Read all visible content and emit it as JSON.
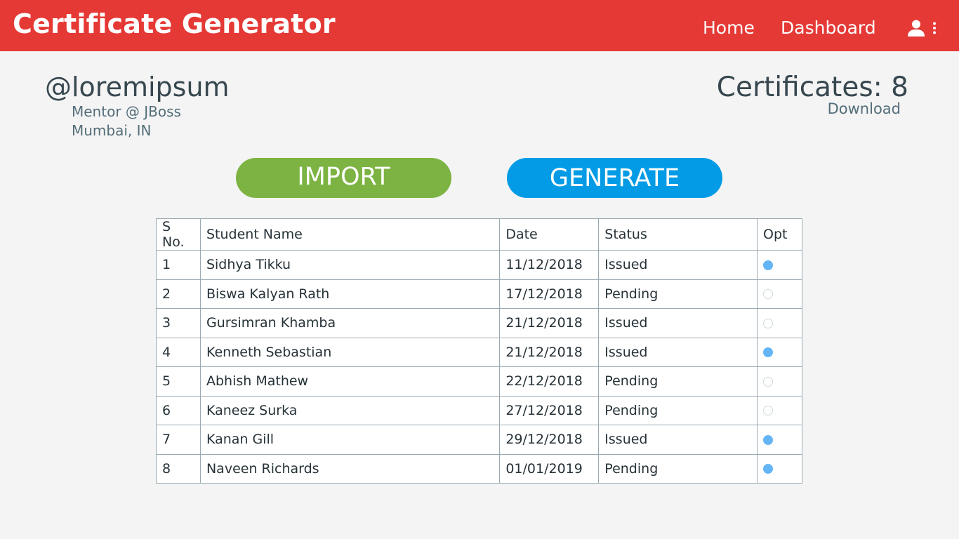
{
  "header": {
    "title": "Certificate Generator",
    "nav": {
      "home": "Home",
      "dashboard": "Dashboard"
    },
    "icons": {
      "user": "user-icon",
      "menu": "more-vertical-icon"
    }
  },
  "profile": {
    "handle": "@loremipsum",
    "role": "Mentor @ JBoss",
    "location": "Mumbai, IN"
  },
  "certificates": {
    "label": "Certificates: 8",
    "download": "Download"
  },
  "actions": {
    "import": "IMPORT",
    "generate": "GENERATE"
  },
  "table": {
    "headers": [
      "S No.",
      "Student Name",
      "Date",
      "Status",
      "Opt"
    ],
    "rows": [
      {
        "sno": "1",
        "name": "Sidhya Tikku",
        "date": "11/12/2018",
        "status": "Issued",
        "selected": true
      },
      {
        "sno": "2",
        "name": "Biswa Kalyan Rath",
        "date": "17/12/2018",
        "status": "Pending",
        "selected": false
      },
      {
        "sno": "3",
        "name": "Gursimran Khamba",
        "date": "21/12/2018",
        "status": "Issued",
        "selected": false
      },
      {
        "sno": "4",
        "name": "Kenneth Sebastian",
        "date": "21/12/2018",
        "status": "Issued",
        "selected": true
      },
      {
        "sno": "5",
        "name": "Abhish Mathew",
        "date": "22/12/2018",
        "status": "Pending",
        "selected": false
      },
      {
        "sno": "6",
        "name": "Kaneez Surka",
        "date": "27/12/2018",
        "status": "Pending",
        "selected": false
      },
      {
        "sno": "7",
        "name": "Kanan Gill",
        "date": "29/12/2018",
        "status": "Issued",
        "selected": true
      },
      {
        "sno": "8",
        "name": "Naveen Richards",
        "date": "01/01/2019",
        "status": "Pending",
        "selected": true
      }
    ]
  },
  "colors": {
    "header_bg": "#e53935",
    "import_bg": "#7cb342",
    "generate_bg": "#039be5",
    "issued": "#2e7d32",
    "pending": "#d32f2f",
    "selected_radio": "#64b5f6"
  }
}
